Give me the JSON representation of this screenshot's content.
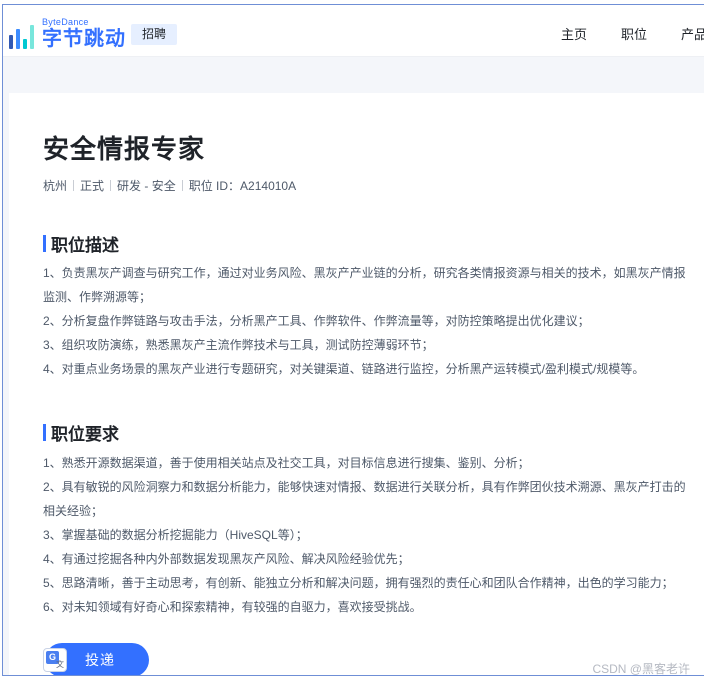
{
  "header": {
    "logo_en": "ByteDance",
    "logo_cn": "字节跳动",
    "badge": "招聘",
    "nav": [
      "主页",
      "职位",
      "产品"
    ]
  },
  "job": {
    "title": "安全情报专家",
    "meta": [
      "杭州",
      "正式",
      "研发 - 安全",
      "职位 ID：A214010A"
    ]
  },
  "description": {
    "heading": "职位描述",
    "items": [
      "1、负责黑灰产调查与研究工作，通过对业务风险、黑灰产产业链的分析，研究各类情报资源与相关的技术，如黑灰产情报",
      "监测、作弊溯源等；",
      "2、分析复盘作弊链路与攻击手法，分析黑产工具、作弊软件、作弊流量等，对防控策略提出优化建议；",
      "3、组织攻防演练，熟悉黑灰产主流作弊技术与工具，测试防控薄弱环节；",
      "4、对重点业务场景的黑灰产业进行专题研究，对关键渠道、链路进行监控，分析黑产运转模式/盈利模式/规模等。"
    ]
  },
  "requirements": {
    "heading": "职位要求",
    "items": [
      "1、熟悉开源数据渠道，善于使用相关站点及社交工具，对目标信息进行搜集、鉴别、分析；",
      "2、具有敏锐的风险洞察力和数据分析能力，能够快速对情报、数据进行关联分析，具有作弊团伙技术溯源、黑灰产打击的",
      "相关经验；",
      "3、掌握基础的数据分析挖掘能力（HiveSQL等）；",
      "4、有通过挖掘各种内外部数据发现黑灰产风险、解决风险经验优先；",
      "5、思路清晰，善于主动思考，有创新、能独立分析和解决问题，拥有强烈的责任心和团队合作精神，出色的学习能力；",
      "6、对未知领域有好奇心和探索精神，有较强的自驱力，喜欢接受挑战。"
    ]
  },
  "apply_label": "投递",
  "translate_icon": "google-translate-icon",
  "translate_glyphs": {
    "g": "G",
    "a": "文"
  },
  "watermark": "CSDN @黑客老许",
  "colors": {
    "accent": "#3370ff",
    "text": "#1f2329",
    "muted": "#4e5969"
  }
}
